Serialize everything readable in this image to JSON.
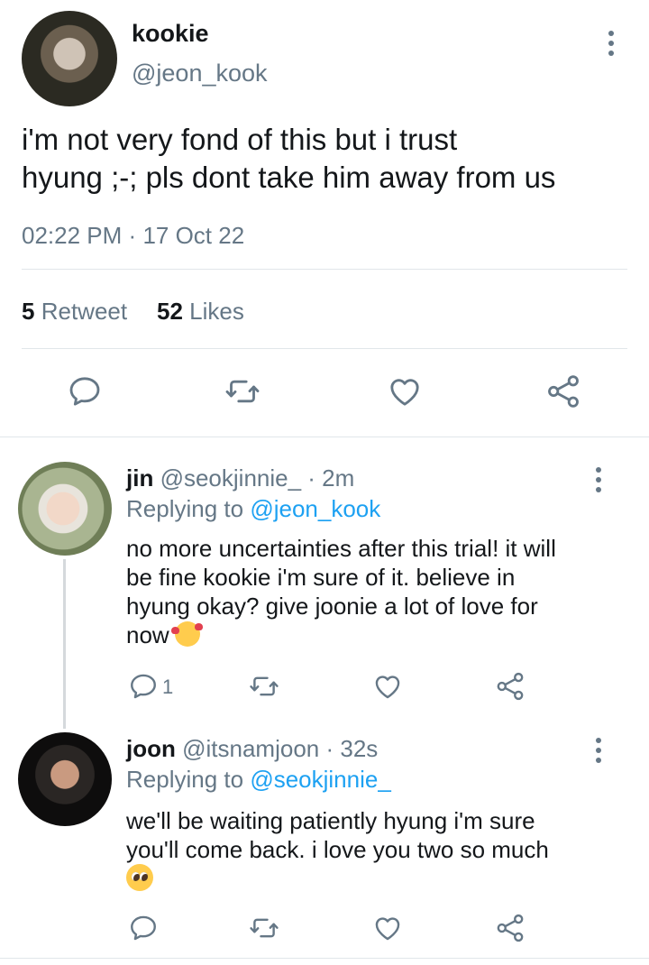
{
  "main_tweet": {
    "display_name": "kookie",
    "handle": "@jeon_kook",
    "text_line1": "i'm not very fond of this but i trust",
    "text_line2": "hyung ;-; pls dont take him away from us",
    "time": "02:22 PM",
    "separator": "·",
    "date": "17 Oct 22",
    "retweet_count": "5",
    "retweet_label": "Retweet",
    "like_count": "52",
    "like_label": "Likes"
  },
  "replies": [
    {
      "display_name": "jin",
      "handle": "@seokjinnie_",
      "meta": "· 2m",
      "replying_label": "Replying to",
      "replying_handle": "@jeon_kook",
      "lines": [
        "no more uncertainties after this trial! it will",
        "be fine kookie i'm sure of it. believe in",
        "hyung okay? give joonie a lot of love for",
        "now"
      ],
      "emoji": "smiling-face-with-hearts",
      "reply_count": "1"
    },
    {
      "display_name": "joon",
      "handle": "@itsnamjoon",
      "meta": "· 32s",
      "replying_label": "Replying to",
      "replying_handle": "@seokjinnie_",
      "lines": [
        "we'll be waiting patiently hyung i'm sure",
        "you'll come back. i love you two so much"
      ],
      "emoji": "pleading-face",
      "reply_count": ""
    }
  ],
  "icons": {
    "reply": "reply-icon",
    "retweet": "retweet-icon",
    "like": "like-icon",
    "share": "share-icon",
    "more": "more-vertical-icon"
  },
  "colors": {
    "text": "#14171a",
    "secondary": "#657786",
    "link": "#1da1f2",
    "divider": "#e1e6ea"
  }
}
